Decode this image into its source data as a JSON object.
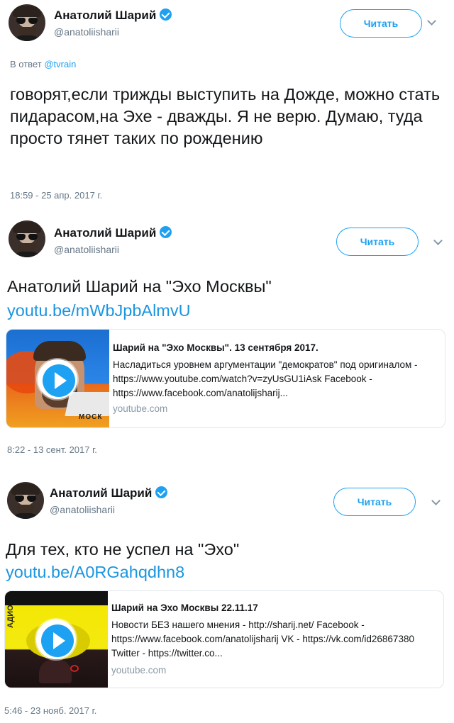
{
  "tweets": [
    {
      "author": "Анатолий Шарий",
      "handle": "@anatoliisharii",
      "follow_label": "Читать",
      "reply_prefix": "В ответ",
      "reply_mention": "@tvrain",
      "text": "говорят,если трижды выступить на Дожде, можно стать пидарасом,на Эхе - дважды. Я не верю. Думаю, туда просто тянет таких по рождению",
      "timestamp": "18:59 - 25 апр. 2017 г."
    },
    {
      "author": "Анатолий Шарий",
      "handle": "@anatoliisharii",
      "follow_label": "Читать",
      "text": "Анатолий Шарий на \"Эхо Москвы\"",
      "link": "youtu.be/mWbJpbAlmvU",
      "card": {
        "title": "Шарий на \"Эхо Москвы\". 13 сентября 2017.",
        "description": "Насладиться уровнем аргументации \"демократов\" под оригиналом - https://www.youtube.com/watch?v=zyUsGU1iAsk Facebook - https://www.facebook.com/anatolijsharij...",
        "domain": "youtube.com",
        "thumb_text": "МОСК"
      },
      "timestamp": "8:22 - 13 сент. 2017 г."
    },
    {
      "author": "Анатолий Шарий",
      "handle": "@anatoliisharii",
      "follow_label": "Читать",
      "text": "Для тех, кто не успел на \"Эхо\"",
      "link": "youtu.be/A0RGahqdhn8",
      "card": {
        "title": "Шарий на Эхо Москвы 22.11.17",
        "description": "Новости БЕЗ нашего мнения - http://sharij.net/ Facebook - https://www.facebook.com/anatolijsharij VK - https://vk.com/id26867380 Twitter - https://twitter.co...",
        "domain": "youtube.com",
        "thumb_text": "АДИО"
      },
      "timestamp": "5:46 - 23 нояб. 2017 г."
    }
  ],
  "colors": {
    "accent": "#1da1f2",
    "link": "#1b95e0",
    "muted": "#657786",
    "border": "#e1e8ed"
  }
}
